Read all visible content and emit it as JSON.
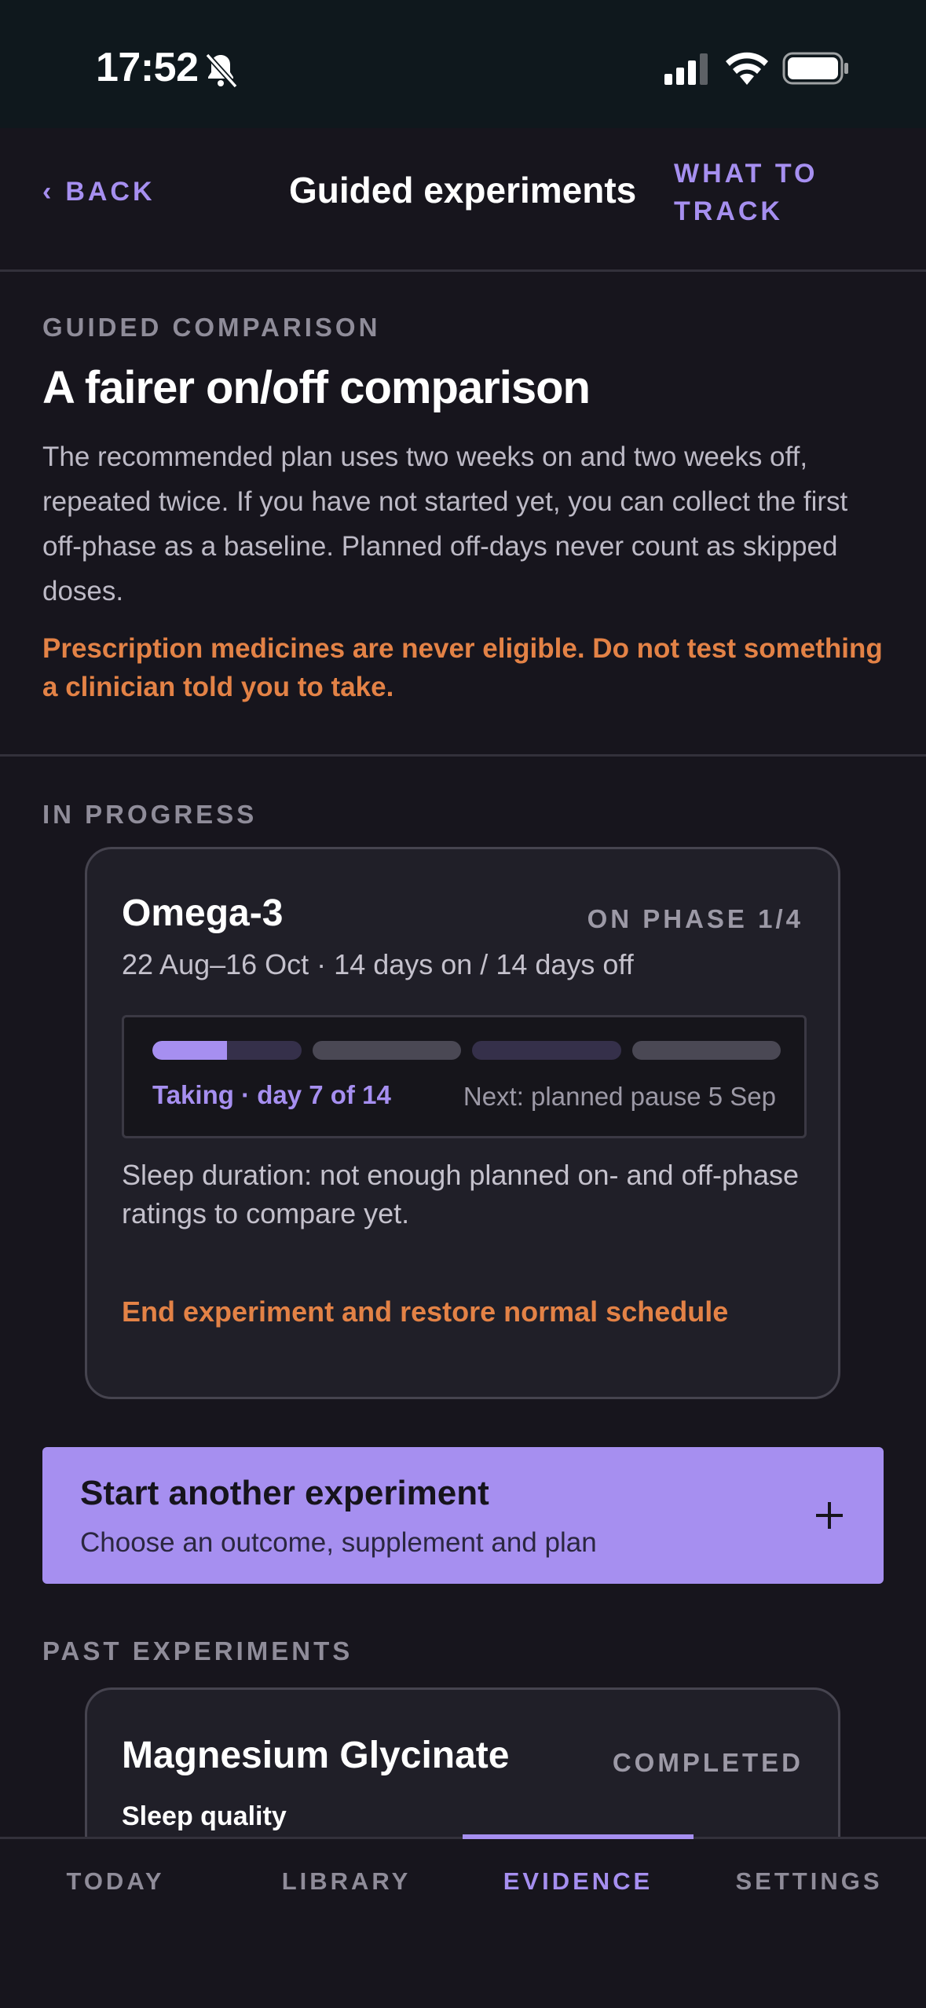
{
  "status_bar": {
    "time": "17:52",
    "icons": [
      "bell-slash-icon",
      "signal-icon",
      "wifi-icon",
      "battery-icon"
    ]
  },
  "header": {
    "back_label": "BACK",
    "title": "Guided experiments",
    "track_label": "WHAT TO TRACK"
  },
  "intro": {
    "eyebrow": "GUIDED COMPARISON",
    "title": "A fairer on/off comparison",
    "body": "The recommended plan uses two weeks on and two weeks off, repeated twice. If you have not started yet, you can collect the first off-phase as a baseline. Planned off-days never count as skipped doses.",
    "warning": "Prescription medicines are never eligible. Do not test something a clinician told you to take."
  },
  "in_progress": {
    "section_label": "IN PROGRESS",
    "experiment": {
      "name": "Omega-3",
      "phase": "ON PHASE 1/4",
      "dates": "22 Aug–16 Oct · 14 days on / 14 days off",
      "current_phase_progress": 0.5,
      "phase_segments": [
        {
          "kind": "on",
          "progress": 0.5
        },
        {
          "kind": "off",
          "progress": 0
        },
        {
          "kind": "on",
          "progress": 0
        },
        {
          "kind": "off",
          "progress": 0
        }
      ],
      "taking_label": "Taking · day 7 of 14",
      "next_label": "Next: planned pause 5 Sep",
      "note": "Sleep duration: not enough planned on- and off-phase ratings to compare yet.",
      "end_label": "End experiment and restore normal schedule"
    }
  },
  "start_button": {
    "title": "Start another experiment",
    "subtitle": "Choose an outcome, supplement and plan",
    "icon": "plus-icon"
  },
  "past": {
    "section_label": "PAST EXPERIMENTS",
    "experiments": [
      {
        "name": "Magnesium Glycinate",
        "status": "COMPLETED",
        "outcome": "Sleep quality"
      }
    ]
  },
  "tabs": [
    {
      "label": "TODAY",
      "active": false
    },
    {
      "label": "LIBRARY",
      "active": false
    },
    {
      "label": "EVIDENCE",
      "active": true
    },
    {
      "label": "SETTINGS",
      "active": false
    }
  ],
  "colors": {
    "accent": "#a68ff0",
    "warning": "#e38246",
    "background": "#17151d",
    "card": "#201f28"
  }
}
